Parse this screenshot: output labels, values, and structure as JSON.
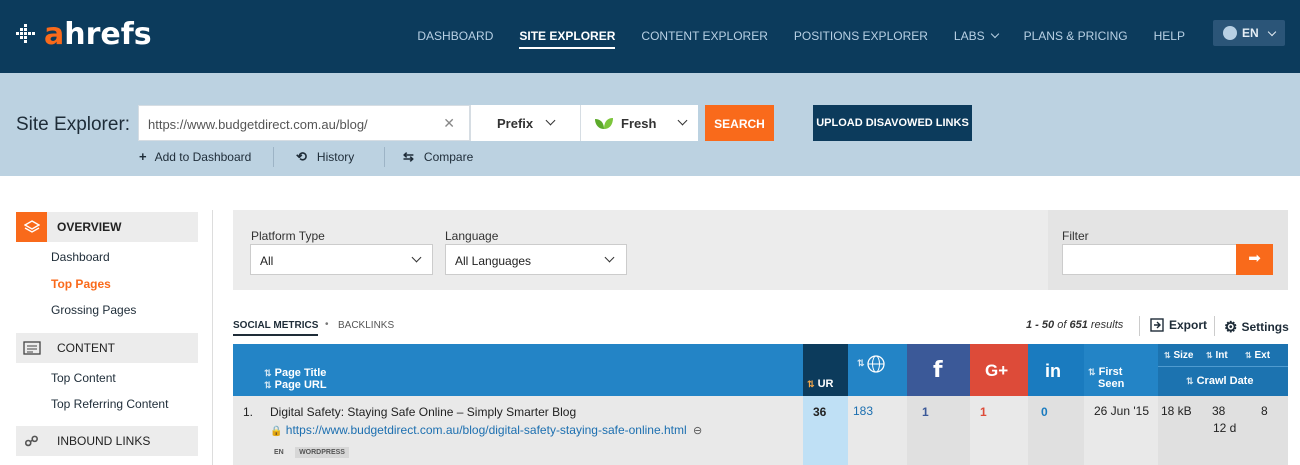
{
  "brand": {
    "name_a": "a",
    "name_rest": "hrefs"
  },
  "nav": {
    "items": [
      "DASHBOARD",
      "SITE EXPLORER",
      "CONTENT EXPLORER",
      "POSITIONS EXPLORER",
      "LABS",
      "PLANS & PRICING",
      "HELP"
    ],
    "active": "SITE EXPLORER",
    "lang": "EN"
  },
  "search": {
    "label": "Site Explorer:",
    "url": "https://www.budgetdirect.com.au/blog/",
    "mode": "Prefix",
    "index": "Fresh",
    "search_btn": "SEARCH",
    "upload_btn": "UPLOAD DISAVOWED LINKS",
    "add_dashboard": "Add to Dashboard",
    "history": "History",
    "compare": "Compare"
  },
  "sidebar": {
    "overview": "OVERVIEW",
    "overview_links": [
      "Dashboard",
      "Top Pages",
      "Grossing Pages"
    ],
    "content": "CONTENT",
    "content_links": [
      "Top Content",
      "Top Referring Content"
    ],
    "inbound": "INBOUND LINKS"
  },
  "filters": {
    "platform_label": "Platform Type",
    "platform_value": "All",
    "language_label": "Language",
    "language_value": "All Languages",
    "filter_label": "Filter"
  },
  "tabs": {
    "social": "SOCIAL METRICS",
    "backlinks": "BACKLINKS"
  },
  "results": {
    "range": "1 - 50",
    "of": "of",
    "total": "651",
    "suffix": "results"
  },
  "actions": {
    "export": "Export",
    "settings": "Settings"
  },
  "table": {
    "headers": {
      "page_title": "Page Title",
      "page_url": "Page URL",
      "ur": "UR",
      "first_seen_1": "First",
      "first_seen_2": "Seen",
      "size": "Size",
      "int": "Int",
      "ext": "Ext",
      "crawl_date": "Crawl Date"
    },
    "rows": [
      {
        "num": "1.",
        "title": "Digital Safety: Staying Safe Online – Simply Smarter Blog",
        "url": "https://www.budgetdirect.com.au/blog/digital-safety-staying-safe-online.html",
        "tag_lang": "EN",
        "tag_platform": "WORDPRESS",
        "ur": "36",
        "www": "183",
        "facebook": "1",
        "gplus": "1",
        "linkedin": "0",
        "first_seen": "26 Jun '15",
        "size": "18 kB",
        "int": "38",
        "ext": "8",
        "crawl": "12 d"
      }
    ]
  },
  "colors": {
    "navy": "#0c3b5c",
    "orange": "#f96a1b",
    "blue": "#2384c6",
    "fb": "#3b5998",
    "gplus": "#dd4b39",
    "linkedin": "#1a7bbf"
  }
}
